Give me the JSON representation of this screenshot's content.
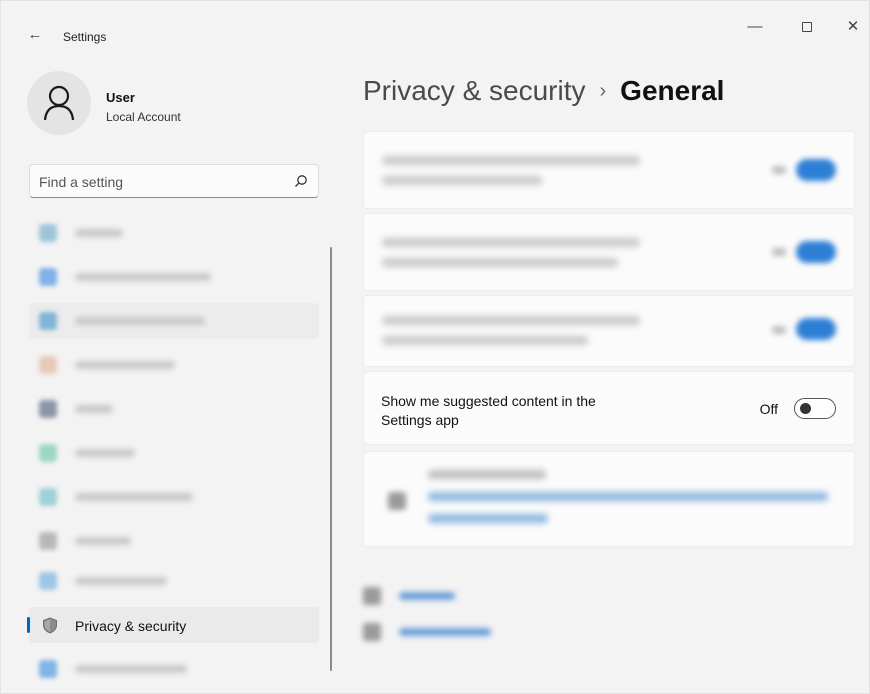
{
  "window": {
    "title": "Settings",
    "controls": {
      "minimize": "—",
      "close": "✕"
    }
  },
  "profile": {
    "name": "User",
    "account_type": "Local Account"
  },
  "search": {
    "placeholder": "Find a setting"
  },
  "nav": {
    "active_item": {
      "label": "Privacy & security",
      "icon": "shield-icon"
    },
    "accent_color": "#0067c0"
  },
  "breadcrumb": {
    "parent": "Privacy & security",
    "separator": "›",
    "current": "General"
  },
  "suggested_content": {
    "label": "Show me suggested content in the Settings app",
    "state_label": "Off"
  },
  "colors": {
    "background": "#f3f3f3",
    "card": "#fbfbfb",
    "toggle_on_blurred": "#2d7fd6"
  }
}
